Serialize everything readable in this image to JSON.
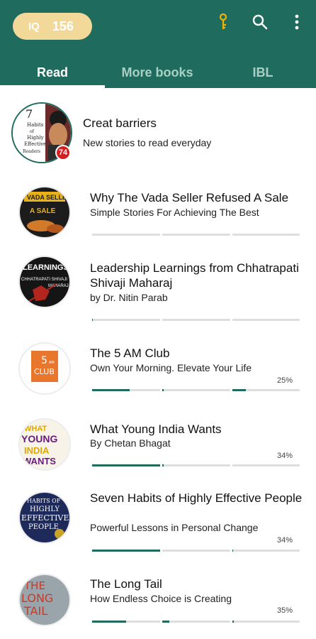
{
  "header": {
    "iq_label": "IQ",
    "iq_value": "156",
    "icons": [
      "key-icon",
      "search-icon",
      "more-vert-icon"
    ],
    "colors": {
      "primary": "#1f6b5e",
      "pill": "#f2d99a",
      "accent": "#f0b400",
      "badge": "#d21f1f"
    }
  },
  "tabs": [
    {
      "label": "Read",
      "active": true
    },
    {
      "label": "More books",
      "active": false
    },
    {
      "label": "IBL",
      "active": false
    }
  ],
  "feature": {
    "title": "Creat barriers",
    "subtitle": "New stories to read everyday",
    "badge_count": "74",
    "cover_lines": [
      "7",
      "Habits",
      "of",
      "Highly",
      "Effective",
      "Readers"
    ]
  },
  "books": [
    {
      "title": "Why The Vada Seller Refused A Sale",
      "subtitle": "Simple Stories For Achieving The Best",
      "percent": "",
      "cover_text": [
        "VADA SELLER",
        "A SALE"
      ],
      "progress": [
        0,
        0,
        0
      ]
    },
    {
      "title": "Leadership Learnings from Chhatrapati Shivaji Maharaj",
      "subtitle": "by Dr. Nitin Parab",
      "percent": "",
      "cover_text": [
        "LEARNINGS",
        "CHHATRAPATI SHIVAJI",
        "MAHARAJ"
      ],
      "progress": [
        0.01,
        0,
        0
      ]
    },
    {
      "title": "The 5 AM Club",
      "subtitle": "Own Your Morning. Elevate Your Life",
      "percent": "25%",
      "cover_text": [
        "5",
        "AM",
        "CLUB"
      ],
      "progress": [
        0.55,
        0.02,
        0.2
      ]
    },
    {
      "title": "What Young India Wants",
      "subtitle": "By Chetan Bhagat",
      "percent": "34%",
      "cover_text": [
        "WHAT",
        "YOUNG",
        "INDIA",
        "WANTS"
      ],
      "progress": [
        1.0,
        0.02,
        0
      ]
    },
    {
      "title": "Seven Habits of Highly Effective People",
      "subtitle": "Powerful Lessons in Personal Change",
      "percent": "34%",
      "cover_text": [
        "HABITS OF",
        "HIGHLY",
        "EFFECTIVE",
        "PEOPLE"
      ],
      "progress": [
        1.0,
        0,
        0.01
      ]
    },
    {
      "title": "The Long Tail",
      "subtitle": "How Endless Choice is Creating",
      "percent": "35%",
      "cover_text": [
        "THE",
        "LONG",
        "TAIL"
      ],
      "progress": [
        0.5,
        0.1,
        0.02
      ]
    }
  ]
}
